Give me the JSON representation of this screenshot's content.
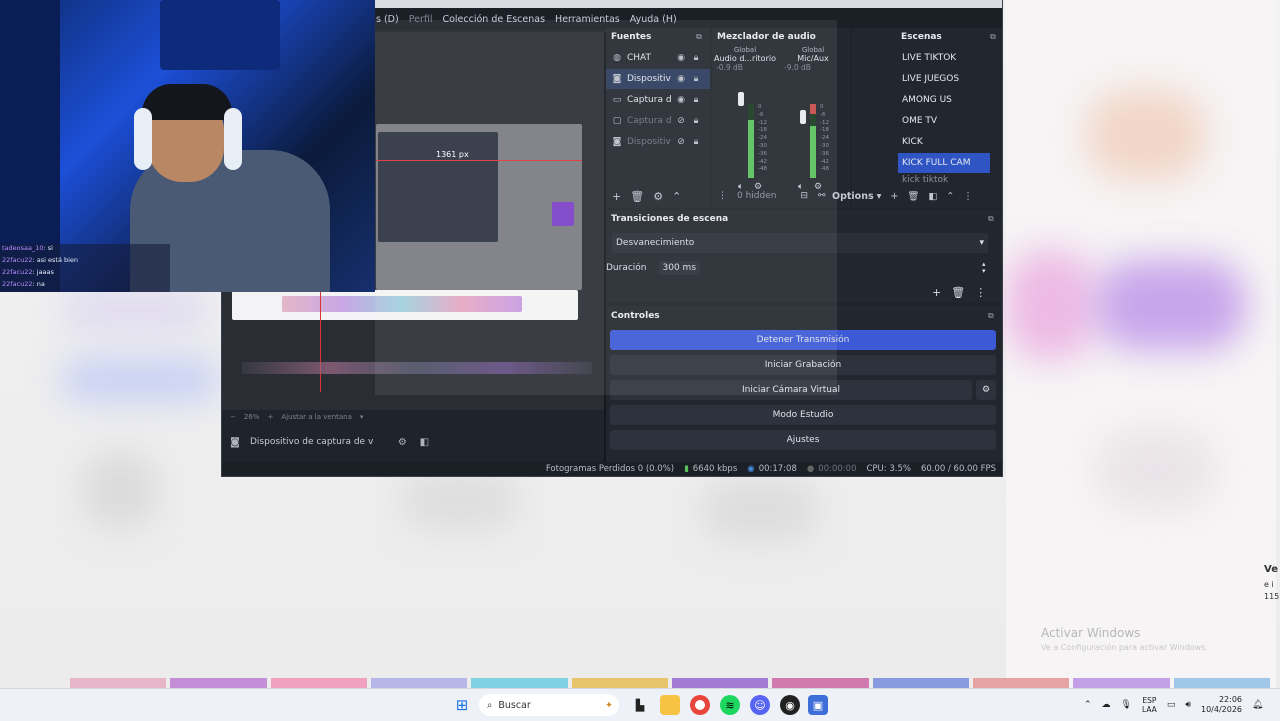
{
  "obs": {
    "menu": [
      {
        "label": "s (D)",
        "dim": false
      },
      {
        "label": "Perfil",
        "dim": true
      },
      {
        "label": "Colección de Escenas",
        "dim": false
      },
      {
        "label": "Herramientas",
        "dim": false
      },
      {
        "label": "Ayuda (H)",
        "dim": false
      }
    ],
    "preview": {
      "measure_label": "1361 px",
      "zoom": "26%",
      "fit_label": "Ajustar a la ventana",
      "source_label": "Dispositivo de captura de v"
    },
    "fuentes": {
      "title": "Fuentes",
      "items": [
        {
          "name": "CHAT",
          "icon": "globe-icon"
        },
        {
          "name": "Dispositiv",
          "icon": "camera-icon",
          "selected": true
        },
        {
          "name": "Captura d",
          "icon": "monitor-icon"
        },
        {
          "name": "Captura d",
          "icon": "window-icon",
          "hidden": true
        },
        {
          "name": "Dispositiv",
          "icon": "camera-icon",
          "hidden": true
        }
      ]
    },
    "mixer": {
      "title": "Mezclador de audio",
      "channels": [
        {
          "head": "Global",
          "name": "Audio d...ritorio",
          "db": "-0.9 dB"
        },
        {
          "head": "Global",
          "name": "Mic/Aux",
          "db": "-9.0 dB"
        }
      ],
      "ticks": [
        "0",
        "-6",
        "-12",
        "-18",
        "-24",
        "-30",
        "-36",
        "-42",
        "-48",
        "-54",
        "-60"
      ],
      "hidden_label": "0 hidden"
    },
    "escenas": {
      "title": "Escenas",
      "items": [
        "LIVE TIKTOK",
        "LIVE JUEGOS",
        "AMONG US",
        "OME TV",
        "KICK",
        "KICK FULL CAM",
        "kick tiktok"
      ],
      "selected_index": 5,
      "options_label": "Options"
    },
    "transiciones": {
      "title": "Transiciones de escena",
      "transition": "Desvanecimiento",
      "duration_label": "Duración",
      "duration_value": "300 ms"
    },
    "controles": {
      "title": "Controles",
      "buttons": [
        "Detener Transmisión",
        "Iniciar Grabación",
        "Iniciar Cámara Virtual",
        "Modo Estudio",
        "Ajustes"
      ]
    },
    "status": {
      "dropped": "Fotogramas Perdidos 0 (0.0%)",
      "bitrate": "6640 kbps",
      "live_time": "00:17:08",
      "rec_time": "00:00:00",
      "cpu": "CPU: 3.5%",
      "fps": "60.00 / 60.00 FPS"
    }
  },
  "webcam_chat": [
    {
      "user": "tadeosaa_10",
      "msg": ": si"
    },
    {
      "user": "22facu22",
      "msg": ": asi está bien"
    },
    {
      "user": "22facu22",
      "msg": ": jaaas"
    },
    {
      "user": "22facu22",
      "msg": ": na"
    }
  ],
  "desktop": {
    "watermark_title": "Activar Windows",
    "watermark_sub": "Ve a Configuración para activar Windows.",
    "edge_text": [
      "Ve",
      "e i",
      "115"
    ]
  },
  "taskbar": {
    "search_placeholder": "Buscar",
    "lang_top": "ESP",
    "lang_bottom": "LAA",
    "time": "22:06",
    "date": "10/4/2026"
  },
  "colors": {
    "obs_bg": "#1f232b",
    "accent": "#3c5ad6",
    "scene_selected": "#2f55c4",
    "meter_green": "#58c15b"
  }
}
